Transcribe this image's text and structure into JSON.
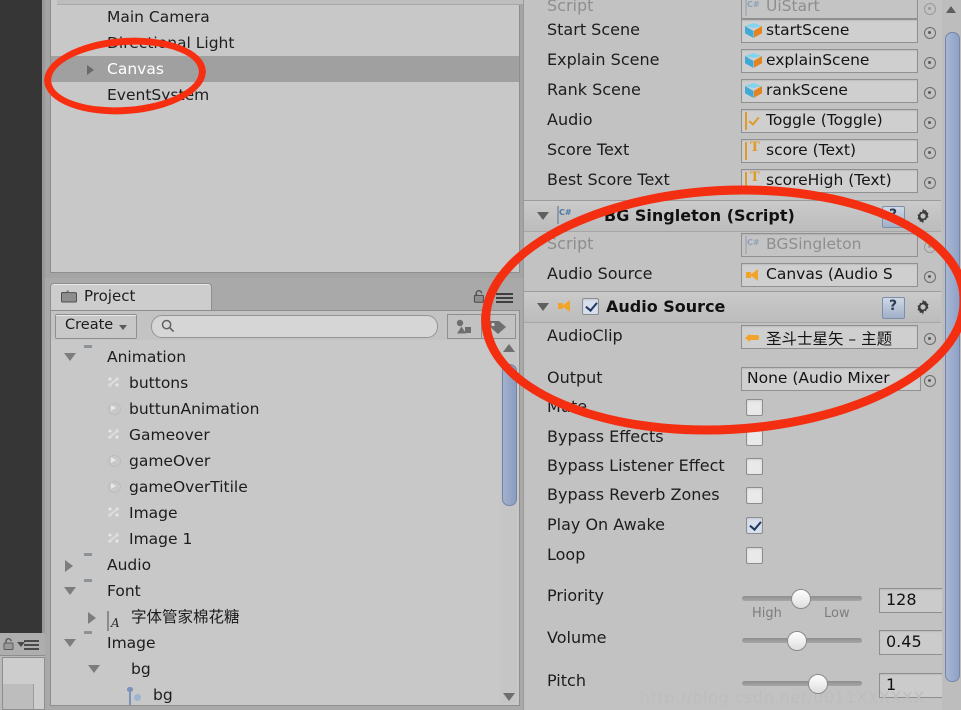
{
  "hierarchy": {
    "items": [
      {
        "label": "Main Camera",
        "selected": false,
        "expandable": false,
        "indent": 0
      },
      {
        "label": "Directional Light",
        "selected": false,
        "expandable": false,
        "indent": 0
      },
      {
        "label": "Canvas",
        "selected": true,
        "expandable": true,
        "indent": 0
      },
      {
        "label": "EventSystem",
        "selected": false,
        "expandable": false,
        "indent": 0
      }
    ]
  },
  "project": {
    "tab_label": "Project",
    "create_label": "Create",
    "search_placeholder": "",
    "search_value": "",
    "icons": {
      "folder": "folder-icon",
      "lock": "lock-icon",
      "menu": "hamburger-menu-icon",
      "search": "search-icon",
      "favorites": "favorites-icon",
      "label": "label-tag-icon"
    },
    "tree": [
      {
        "label": "Animation",
        "type": "folder",
        "state": "expanded",
        "indent": 0
      },
      {
        "label": "buttons",
        "type": "animation-clip",
        "state": "none",
        "indent": 1
      },
      {
        "label": "buttunAnimation",
        "type": "animator-controller",
        "state": "none",
        "indent": 1
      },
      {
        "label": "Gameover",
        "type": "animation-clip",
        "state": "none",
        "indent": 1
      },
      {
        "label": "gameOver",
        "type": "animator-controller",
        "state": "none",
        "indent": 1
      },
      {
        "label": "gameOverTitile",
        "type": "animator-controller",
        "state": "none",
        "indent": 1
      },
      {
        "label": "Image",
        "type": "animation-clip",
        "state": "none",
        "indent": 1
      },
      {
        "label": "Image 1",
        "type": "animation-clip",
        "state": "none",
        "indent": 1
      },
      {
        "label": "Audio",
        "type": "folder",
        "state": "collapsed",
        "indent": 0
      },
      {
        "label": "Font",
        "type": "folder",
        "state": "expanded",
        "indent": 0
      },
      {
        "label": "字体管家棉花糖",
        "type": "font",
        "state": "collapsed",
        "indent": 1
      },
      {
        "label": "Image",
        "type": "folder",
        "state": "expanded",
        "indent": 0
      },
      {
        "label": "bg",
        "type": "texture",
        "state": "expanded",
        "indent": 1
      },
      {
        "label": "bg",
        "type": "sprite",
        "state": "none",
        "indent": 2
      }
    ]
  },
  "inspector": {
    "ui_start_rows": [
      {
        "label": "Script",
        "value": "UiStart",
        "icon": "csharp-script-icon",
        "dim": true
      },
      {
        "label": "Start Scene",
        "value": "startScene",
        "icon": "prefab-cube-icon",
        "dim": false
      },
      {
        "label": "Explain Scene",
        "value": "explainScene",
        "icon": "prefab-cube-icon",
        "dim": false
      },
      {
        "label": "Rank Scene",
        "value": "rankScene",
        "icon": "prefab-cube-icon",
        "dim": false
      },
      {
        "label": "Audio",
        "value": "Toggle (Toggle)",
        "icon": "toggle-icon",
        "dim": false
      },
      {
        "label": "Score Text",
        "value": "score (Text)",
        "icon": "text-icon",
        "dim": false
      },
      {
        "label": "Best Score Text",
        "value": "scoreHigh (Text)",
        "icon": "text-icon",
        "dim": false
      }
    ],
    "bg_singleton": {
      "title": "BG Singleton (Script)",
      "icon": "csharp-script-icon",
      "rows": [
        {
          "label": "Script",
          "value": "BGSingleton",
          "icon": "csharp-script-icon",
          "dim": true
        },
        {
          "label": "Audio Source",
          "value": "Canvas (Audio S",
          "icon": "speaker-icon",
          "dim": false
        }
      ]
    },
    "audio_source": {
      "title": "Audio Source",
      "icon": "speaker-icon",
      "enabled": true,
      "object_rows": [
        {
          "label": "AudioClip",
          "value": "圣斗士星矢 – 主题",
          "icon": "audio-clip-icon"
        },
        {
          "label": "Output",
          "value": "None (Audio Mixer",
          "icon": "none"
        }
      ],
      "toggles": [
        {
          "label": "Mute",
          "checked": false
        },
        {
          "label": "Bypass Effects",
          "checked": false
        },
        {
          "label": "Bypass Listener Effect",
          "checked": false
        },
        {
          "label": "Bypass Reverb Zones",
          "checked": false
        },
        {
          "label": "Play On Awake",
          "checked": true
        },
        {
          "label": "Loop",
          "checked": false
        }
      ],
      "sliders": [
        {
          "label": "Priority",
          "value": "128",
          "pos": 0.48,
          "left_hint": "High",
          "right_hint": "Low"
        },
        {
          "label": "Volume",
          "value": "0.45",
          "pos": 0.45,
          "left_hint": "",
          "right_hint": ""
        },
        {
          "label": "Pitch",
          "value": "1",
          "pos": 0.62,
          "left_hint": "",
          "right_hint": ""
        }
      ]
    },
    "help_label": "?",
    "gear_label": "settings-gear-icon"
  },
  "annotation": {
    "color": "#f72f10",
    "shapes": [
      "ellipse-around-canvas-item",
      "ellipse-around-bg-singleton-and-audio-source"
    ]
  },
  "watermark": {
    "text": "http://blog.csdn.net/u011XXXXXX"
  }
}
